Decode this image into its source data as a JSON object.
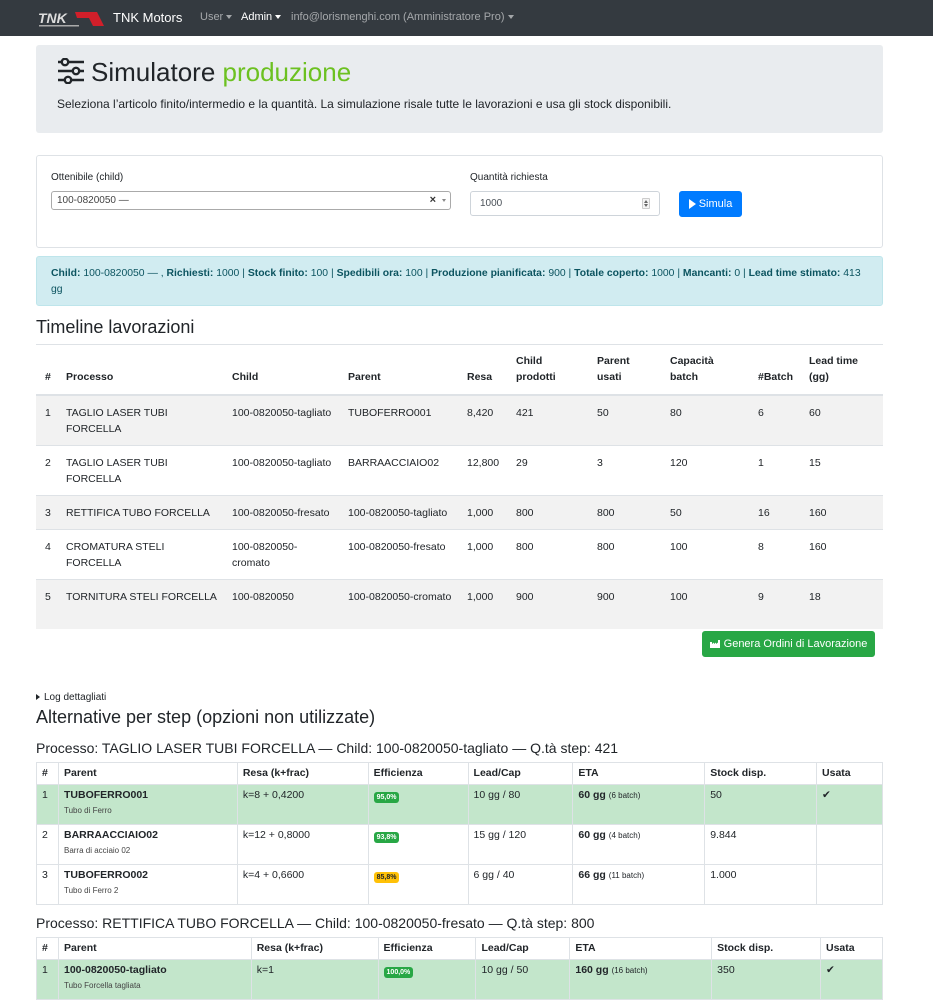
{
  "navbar": {
    "brand": "TNK Motors",
    "menu": [
      {
        "label": "User",
        "active": false
      },
      {
        "label": "Admin",
        "active": true
      },
      {
        "label": "info@lorismenghi.com (Amministratore Pro)",
        "active": false
      }
    ]
  },
  "header": {
    "title_main": "Simulatore",
    "title_accent": "produzione",
    "lead": "Seleziona l’articolo finito/intermedio e la quantità. La simulazione risale tutte le lavorazioni e usa gli stock disponibili."
  },
  "form": {
    "child_label": "Ottenibile (child)",
    "child_value": "100-0820050 —",
    "clear_symbol": "×",
    "qty_label": "Quantità richiesta",
    "qty_value": "1000",
    "simulate_label": "Simula"
  },
  "summary": {
    "items": [
      {
        "k": "Child:",
        "v": "100-0820050 —"
      },
      {
        "k": "Richiesti:",
        "v": "1000"
      },
      {
        "k": "Stock finito:",
        "v": "100"
      },
      {
        "k": "Spedibili ora:",
        "v": "100"
      },
      {
        "k": "Produzione pianificata:",
        "v": "900"
      },
      {
        "k": "Totale coperto:",
        "v": "1000"
      },
      {
        "k": "Mancanti:",
        "v": "0"
      },
      {
        "k": "Lead time stimato:",
        "v": "413 gg"
      }
    ]
  },
  "timeline": {
    "title": "Timeline lavorazioni",
    "headers": [
      "#",
      "Processo",
      "Child",
      "Parent",
      "Resa",
      "Child prodotti",
      "Parent usati",
      "Capacità batch",
      "#Batch",
      "Lead time (gg)"
    ],
    "rows": [
      {
        "n": "1",
        "processo": "TAGLIO LASER TUBI FORCELLA",
        "child": "100-0820050-tagliato",
        "parent": "TUBOFERRO001",
        "resa": "8,420",
        "child_prod": "421",
        "parent_usati": "50",
        "capacita": "80",
        "batch": "6",
        "lead": "60"
      },
      {
        "n": "2",
        "processo": "TAGLIO LASER TUBI FORCELLA",
        "child": "100-0820050-tagliato",
        "parent": "BARRAACCIAIO02",
        "resa": "12,800",
        "child_prod": "29",
        "parent_usati": "3",
        "capacita": "120",
        "batch": "1",
        "lead": "15"
      },
      {
        "n": "3",
        "processo": "RETTIFICA TUBO FORCELLA",
        "child": "100-0820050-fresato",
        "parent": "100-0820050-tagliato",
        "resa": "1,000",
        "child_prod": "800",
        "parent_usati": "800",
        "capacita": "50",
        "batch": "16",
        "lead": "160"
      },
      {
        "n": "4",
        "processo": "CROMATURA STELI FORCELLA",
        "child": "100-0820050-cromato",
        "parent": "100-0820050-fresato",
        "resa": "1,000",
        "child_prod": "800",
        "parent_usati": "800",
        "capacita": "100",
        "batch": "8",
        "lead": "160"
      },
      {
        "n": "5",
        "processo": "TORNITURA STELI FORCELLA",
        "child": "100-0820050",
        "parent": "100-0820050-cromato",
        "resa": "1,000",
        "child_prod": "900",
        "parent_usati": "900",
        "capacita": "100",
        "batch": "9",
        "lead": "18"
      }
    ],
    "generate_label": "Genera Ordini di Lavorazione"
  },
  "details_label": "Log dettagliati",
  "alternatives": {
    "title": "Alternative per step (opzioni non utilizzate)",
    "headers": [
      "#",
      "Parent",
      "Resa (k+frac)",
      "Efficienza",
      "Lead/Cap",
      "ETA",
      "Stock disp.",
      "Usata"
    ],
    "groups": [
      {
        "heading": "Processo: TAGLIO LASER TUBI FORCELLA — Child: 100-0820050-tagliato — Q.tà step: 421",
        "rows": [
          {
            "n": "1",
            "parent": "TUBOFERRO001",
            "desc": "Tubo di Ferro",
            "resa": "k=8 + 0,4200",
            "eff": "95,0%",
            "eff_color": "green",
            "leadcap": "10 gg / 80",
            "eta": "60 gg",
            "eta_batch": "(6 batch)",
            "stock": "50",
            "usata": "✔",
            "used": true
          },
          {
            "n": "2",
            "parent": "BARRAACCIAIO02",
            "desc": "Barra di acciaio 02",
            "resa": "k=12 + 0,8000",
            "eff": "93,8%",
            "eff_color": "green",
            "leadcap": "15 gg / 120",
            "eta": "60 gg",
            "eta_batch": "(4 batch)",
            "stock": "9.844",
            "usata": "",
            "used": false
          },
          {
            "n": "3",
            "parent": "TUBOFERRO002",
            "desc": "Tubo di Ferro 2",
            "resa": "k=4 + 0,6600",
            "eff": "85,8%",
            "eff_color": "yellow",
            "leadcap": "6 gg / 40",
            "eta": "66 gg",
            "eta_batch": "(11 batch)",
            "stock": "1.000",
            "usata": "",
            "used": false
          }
        ]
      },
      {
        "heading": "Processo: RETTIFICA TUBO FORCELLA — Child: 100-0820050-fresato — Q.tà step: 800",
        "rows": [
          {
            "n": "1",
            "parent": "100-0820050-tagliato",
            "desc": "Tubo Forcella tagliata",
            "resa": "k=1",
            "eff": "100,0%",
            "eff_color": "green",
            "leadcap": "10 gg / 50",
            "eta": "160 gg",
            "eta_batch": "(16 batch)",
            "stock": "350",
            "usata": "✔",
            "used": true
          }
        ]
      }
    ]
  },
  "colors": {
    "navbar": "#343a40",
    "accent_green": "#6cc121",
    "primary": "#007bff",
    "success": "#28a745",
    "info_bg": "#d1ecf1",
    "used_row": "#c3e6cb"
  }
}
